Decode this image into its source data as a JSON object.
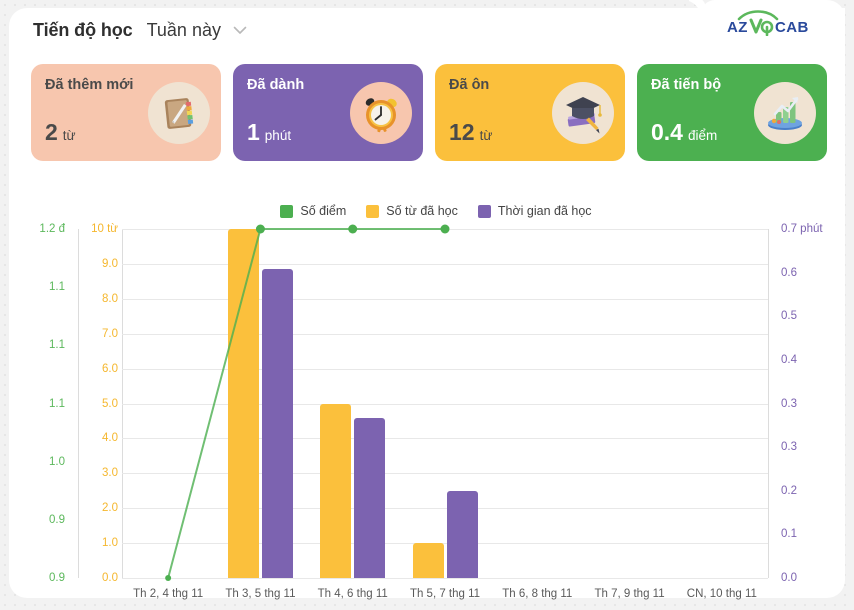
{
  "header": {
    "title": "Tiến độ học",
    "period_value": "Tuần này",
    "chevron_icon": "chevron-down-icon"
  },
  "brand": {
    "logo_text": "AZVOCAB",
    "logo_color": "#2a4a9c",
    "logo_accent": "#5cb85c"
  },
  "cards": [
    {
      "label": "Đã thêm mới",
      "value": "2",
      "unit": "từ",
      "bg": "#f7c6ae",
      "icon": "notebook-icon"
    },
    {
      "label": "Đã dành",
      "value": "1",
      "unit": "phút",
      "bg": "#7c63b0",
      "icon": "alarm-clock-icon"
    },
    {
      "label": "Đã ôn",
      "value": "12",
      "unit": "từ",
      "bg": "#fbc03c",
      "icon": "graduation-cap-icon"
    },
    {
      "label": "Đã tiến bộ",
      "value": "0.4",
      "unit": "điểm",
      "bg": "#4cb050",
      "icon": "growth-chart-icon"
    }
  ],
  "chart_data": {
    "type": "bar",
    "title": "Tiến độ học",
    "xlabel": "",
    "ylabel": "",
    "grid": true,
    "legend_position": "top-center",
    "categories": [
      "Th 2, 4 thg 11",
      "Th 3, 5 thg 11",
      "Th 4, 6 thg 11",
      "Th 5, 7 thg 11",
      "Th 6, 8 thg 11",
      "Th 7, 9 thg 11",
      "CN, 10 thg 11"
    ],
    "series": [
      {
        "name": "Số điểm",
        "type": "line",
        "color": "#4caf50",
        "axis": "left-outer",
        "unit": "đ",
        "values": [
          0.9,
          1.2,
          1.2,
          1.2,
          null,
          null,
          null
        ]
      },
      {
        "name": "Số từ đã học",
        "type": "bar",
        "color": "#fbc03c",
        "axis": "left-inner",
        "unit": "từ",
        "values": [
          0,
          10,
          5,
          1,
          0,
          0,
          0
        ]
      },
      {
        "name": "Thời gian đã học",
        "type": "bar",
        "color": "#7c63b0",
        "axis": "right",
        "unit": "phút",
        "values": [
          0,
          0.62,
          0.32,
          0.175,
          0,
          0,
          0
        ]
      }
    ],
    "axes": {
      "left_outer": {
        "color": "#5cb85c",
        "unit": "đ",
        "ticks": [
          "1.2 đ",
          "1.1",
          "1.1",
          "1.1",
          "1.0",
          "0.9",
          "0.9"
        ],
        "range": [
          0.9,
          1.2
        ]
      },
      "left_inner": {
        "color": "#f5b72e",
        "unit": "từ",
        "ticks": [
          "10 từ",
          "9.0",
          "8.0",
          "7.0",
          "6.0",
          "5.0",
          "4.0",
          "3.0",
          "2.0",
          "1.0",
          "0.0"
        ],
        "range": [
          0,
          10
        ]
      },
      "right": {
        "color": "#7c63b0",
        "unit": "phút",
        "ticks": [
          "0.7 phút",
          "0.6",
          "0.5",
          "0.4",
          "0.3",
          "0.3",
          "0.2",
          "0.1",
          "0.0"
        ],
        "range": [
          0,
          0.7
        ]
      }
    }
  }
}
